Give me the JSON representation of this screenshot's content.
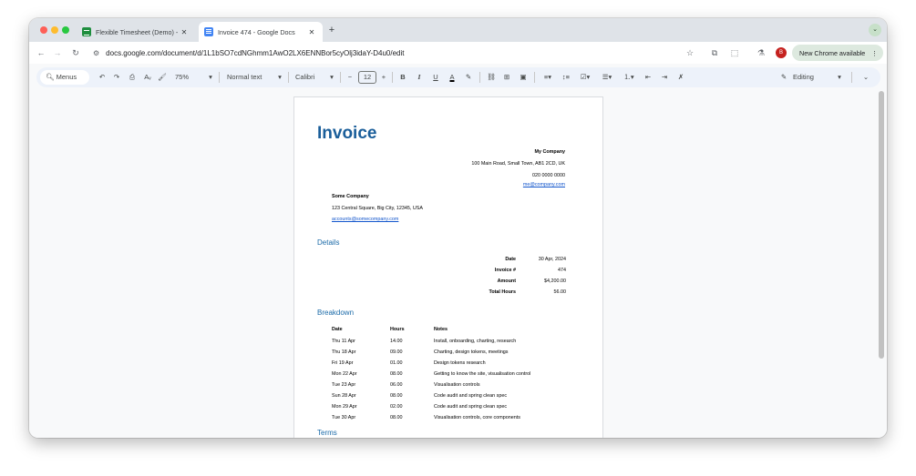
{
  "browser": {
    "tabs": [
      {
        "title": "Flexible Timesheet (Demo) - "
      },
      {
        "title": "Invoice 474 - Google Docs"
      }
    ],
    "url": "docs.google.com/document/d/1L1bSO7cdNGhmm1AwO2LX6ENNBor5cyOlj3idaY-D4u0/edit",
    "update_label": "New Chrome available",
    "profile_initial": "B"
  },
  "toolbar": {
    "menus_label": "Menus",
    "zoom": "75%",
    "style": "Normal text",
    "font": "Calibri",
    "font_size": "12",
    "mode": "Editing"
  },
  "doc": {
    "title": "Invoice",
    "sender": {
      "name": "My Company",
      "address": "100 Main Road, Small Town, AB1 2CD, UK",
      "phone": "020 0000 0000",
      "email": "me@company.com"
    },
    "client": {
      "name": "Some Company",
      "address": "123 Central Square, Big City, 12345, USA",
      "email": "accounts@somecompany.com"
    },
    "details_heading": "Details",
    "details": [
      {
        "key": "Date",
        "value": "30 Apr, 2024"
      },
      {
        "key": "Invoice #",
        "value": "474"
      },
      {
        "key": "Amount",
        "value": "$4,200.00"
      },
      {
        "key": "Total Hours",
        "value": "56.00"
      }
    ],
    "breakdown_heading": "Breakdown",
    "breakdown_headers": [
      "Date",
      "Hours",
      "Notes"
    ],
    "breakdown_rows": [
      [
        "Thu 11 Apr",
        "14.00",
        "Install, onboarding, charting, research"
      ],
      [
        "Thu 18 Apr",
        "09.00",
        "Charting, design tokens, meetings"
      ],
      [
        "Fri 19 Apr",
        "01.00",
        "Design tokens research"
      ],
      [
        "Mon 22 Apr",
        "08.00",
        "Getting to know the site, visualisation control"
      ],
      [
        "Tue 23 Apr",
        "06.00",
        "Visualisation controls"
      ],
      [
        "Sun 28 Apr",
        "08.00",
        "Code audit and spring clean spec"
      ],
      [
        "Mon 29 Apr",
        "02.00",
        "Code audit and spring clean spec"
      ],
      [
        "Tue 30 Apr",
        "08.00",
        "Visualisation controls, core components"
      ]
    ],
    "terms_heading": "Terms"
  }
}
